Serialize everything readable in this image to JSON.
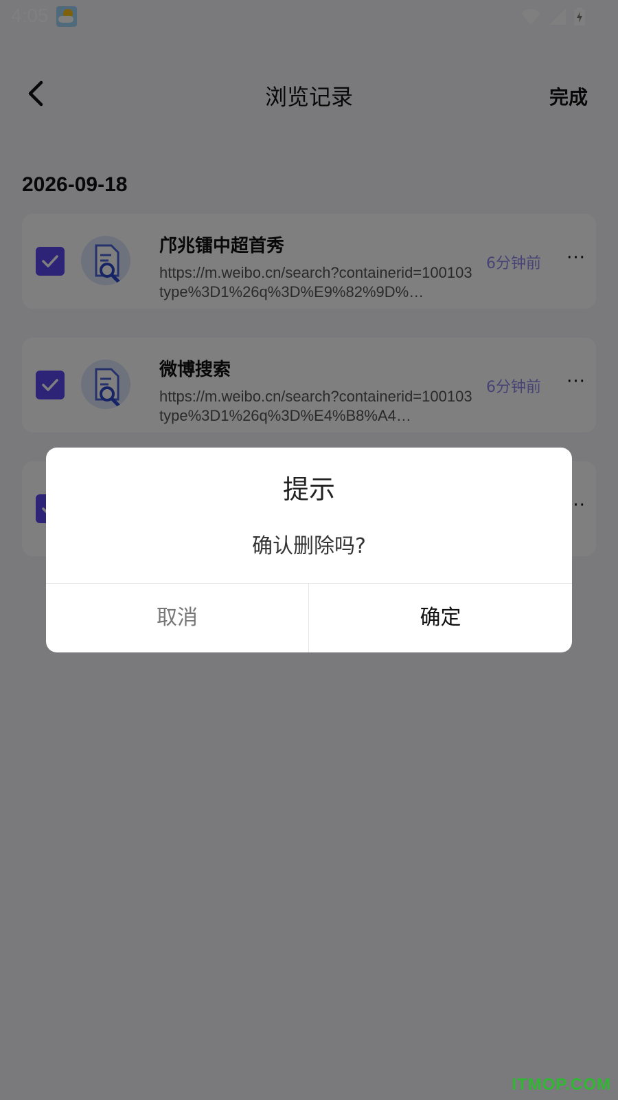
{
  "status_bar": {
    "time": "4:05",
    "icons": [
      "weather-icon",
      "wifi-icon",
      "signal-icon",
      "battery-charging-icon"
    ]
  },
  "header": {
    "back_icon": "chevron-left-icon",
    "title": "浏览记录",
    "done_label": "完成"
  },
  "date_group": "2026-09-18",
  "history_items": [
    {
      "checked": true,
      "icon": "search-document-icon",
      "title": "邝兆镭中超首秀",
      "url": "https://m.weibo.cn/search?containerid=100103type%3D1%26q%3D%E9%82%9D%…",
      "time": "6分钟前",
      "more_icon": "more-horizontal-icon"
    },
    {
      "checked": true,
      "icon": "search-document-icon",
      "title": "微博搜索",
      "url": "https://m.weibo.cn/search?containerid=100103type%3D1%26q%3D%E4%B8%A4…",
      "time": "6分钟前",
      "more_icon": "more-horizontal-icon"
    },
    {
      "checked": true,
      "icon": "search-document-icon",
      "title": "",
      "url": "",
      "time": "",
      "more_icon": "more-horizontal-icon"
    }
  ],
  "dialog": {
    "title": "提示",
    "message": "确认删除吗?",
    "cancel_label": "取消",
    "confirm_label": "确定"
  },
  "colors": {
    "accent": "#5b48f0",
    "time_text": "#8f86ec",
    "overlay": "rgba(0,0,0,0.5)",
    "watermark": "#2fb832"
  },
  "watermark": "ITMOP.COM"
}
